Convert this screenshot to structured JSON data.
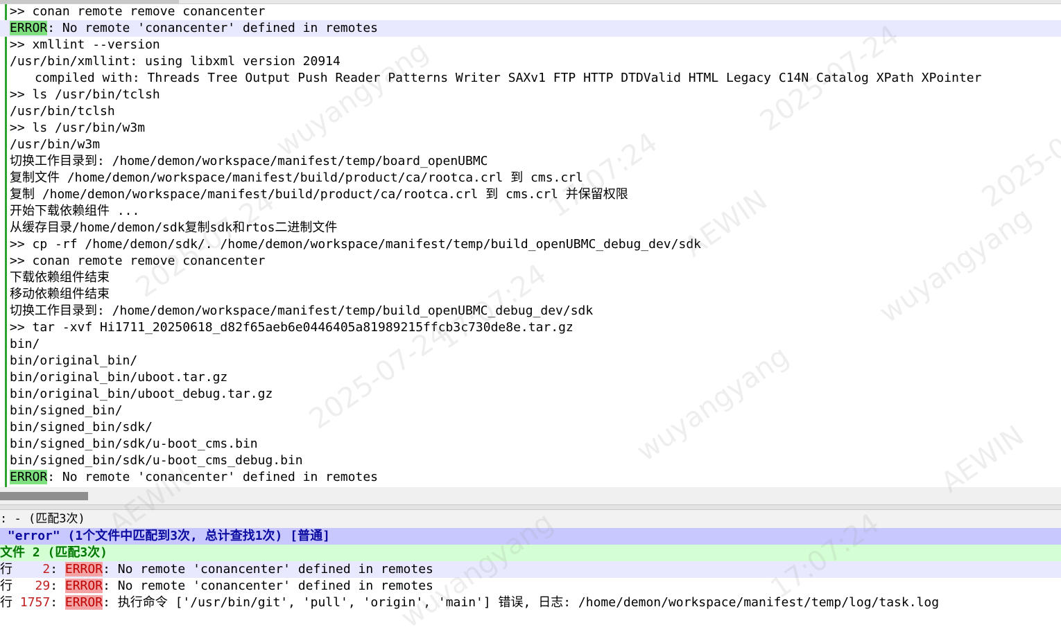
{
  "editor": {
    "lines": [
      {
        "text": ">> conan remote remove conancenter"
      },
      {
        "tag": "ERROR",
        "text": ": No remote 'conancenter' defined in remotes",
        "current": true
      },
      {
        "text": ">> xmllint --version"
      },
      {
        "text": "/usr/bin/xmllint: using libxml version 20914"
      },
      {
        "text": "compiled with: Threads Tree Output Push Reader Patterns Writer SAXv1 FTP HTTP DTDValid HTML Legacy C14N Catalog XPath XPointer",
        "indent": true
      },
      {
        "text": ">> ls /usr/bin/tclsh"
      },
      {
        "text": "/usr/bin/tclsh"
      },
      {
        "text": ">> ls /usr/bin/w3m"
      },
      {
        "text": "/usr/bin/w3m"
      },
      {
        "text": "切换工作目录到: /home/demon/workspace/manifest/temp/board_openUBMC"
      },
      {
        "text": "复制文件 /home/demon/workspace/manifest/build/product/ca/rootca.crl 到 cms.crl"
      },
      {
        "text": "复制 /home/demon/workspace/manifest/build/product/ca/rootca.crl 到 cms.crl 并保留权限"
      },
      {
        "text": "开始下载依赖组件 ..."
      },
      {
        "text": "从缓存目录/home/demon/sdk复制sdk和rtos二进制文件"
      },
      {
        "text": ">> cp -rf /home/demon/sdk/. /home/demon/workspace/manifest/temp/build_openUBMC_debug_dev/sdk"
      },
      {
        "text": ">> conan remote remove conancenter"
      },
      {
        "text": "下载依赖组件结束"
      },
      {
        "text": "移动依赖组件结束"
      },
      {
        "text": "切换工作目录到: /home/demon/workspace/manifest/temp/build_openUBMC_debug_dev/sdk"
      },
      {
        "text": ">> tar -xvf Hi1711_20250618_d82f65aeb6e0446405a81989215ffcb3c730de8e.tar.gz"
      },
      {
        "text": "bin/"
      },
      {
        "text": "bin/original_bin/"
      },
      {
        "text": "bin/original_bin/uboot.tar.gz"
      },
      {
        "text": "bin/original_bin/uboot_debug.tar.gz"
      },
      {
        "text": "bin/signed_bin/"
      },
      {
        "text": "bin/signed_bin/sdk/"
      },
      {
        "text": "bin/signed_bin/sdk/u-boot_cms.bin"
      },
      {
        "text": "bin/signed_bin/sdk/u-boot_cms_debug.bin"
      },
      {
        "tag": "ERROR",
        "text": ": No remote 'conancenter' defined in remotes"
      }
    ]
  },
  "results": {
    "title": "- (匹配3次)",
    "title_prefix": ":",
    "search_line": "\"error\" (1个文件中匹配到3次, 总计查找1次) [普通]",
    "file_line": "文件 2 (匹配3次)",
    "hits": [
      {
        "prefix": "行",
        "num": "    2",
        "tag": "ERROR",
        "text": ": No remote 'conancenter' defined in remotes",
        "current": true
      },
      {
        "prefix": "行",
        "num": "   29",
        "tag": "ERROR",
        "text": ": No remote 'conancenter' defined in remotes"
      },
      {
        "prefix": "行",
        "num": " 1757",
        "tag": "ERROR",
        "text": ": 执行命令 ['/usr/bin/git', 'pull', 'origin', 'main'] 错误, 日志: /home/demon/workspace/manifest/temp/log/task.log"
      }
    ]
  },
  "colors": {
    "error_tag_bg": "#7fe07f",
    "current_line_bg": "#e8e8ff",
    "search_header_bg": "#c8c8ff",
    "file_header_bg": "#d4ffd4",
    "hit_highlight_bg": "#f3a3a3",
    "change_bar": "#2ea42e"
  },
  "watermark": {
    "texts": [
      "wuyangyang",
      "2025-07-24",
      "17:07:24",
      "AEWIN"
    ]
  }
}
